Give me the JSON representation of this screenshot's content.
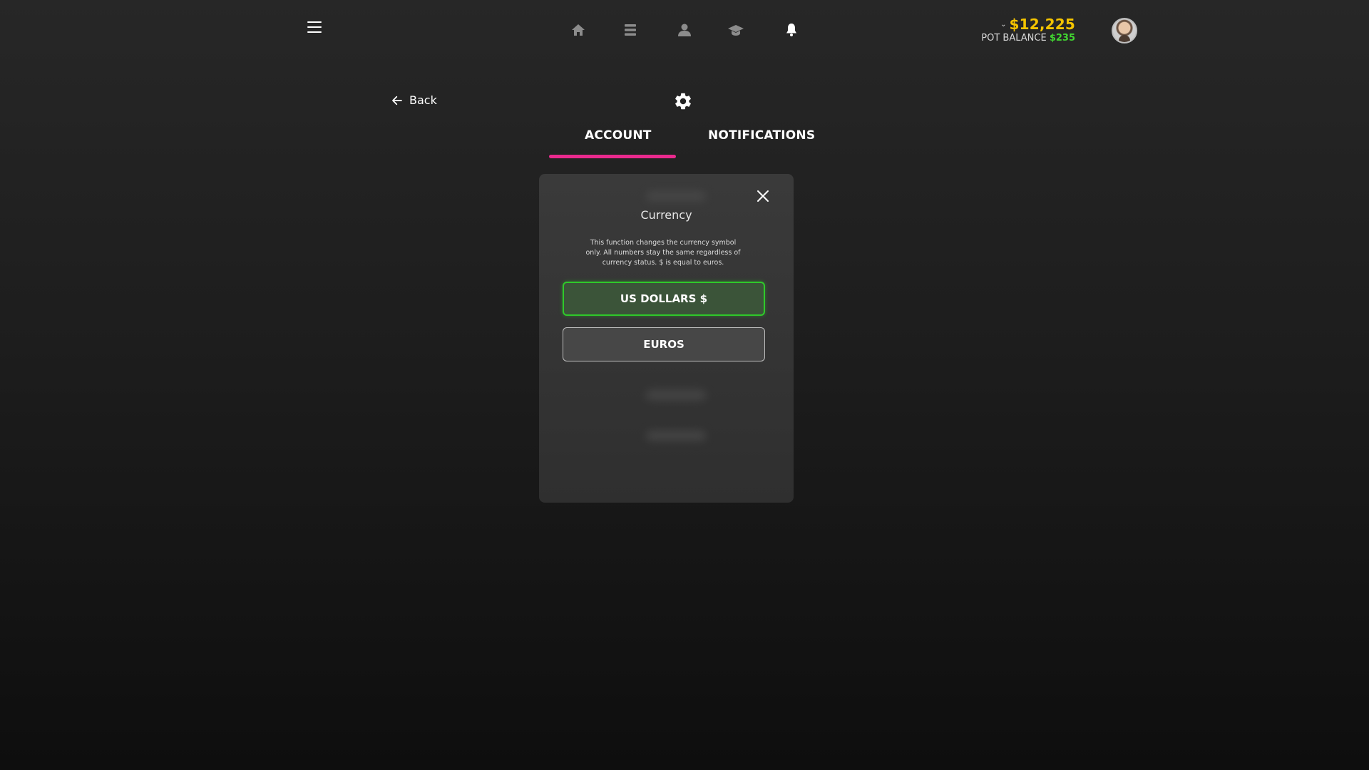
{
  "topbar": {
    "nav": [
      {
        "icon": "home-icon"
      },
      {
        "icon": "list-icon"
      },
      {
        "icon": "user-icon"
      },
      {
        "icon": "graduation-cap-icon"
      },
      {
        "icon": "bell-icon"
      }
    ],
    "balance": "$12,225",
    "pot_label": "POT BALANCE",
    "pot_amount": "$235"
  },
  "header": {
    "back_label": "Back"
  },
  "tabs": [
    {
      "label": "ACCOUNT",
      "active": true
    },
    {
      "label": "NOTIFICATIONS",
      "active": false
    }
  ],
  "modal": {
    "title": "Currency",
    "description": "This function changes the currency symbol only. All numbers stay the same regardless of currency status. $ is equal to euros.",
    "options": [
      {
        "label": "US DOLLARS $",
        "selected": true
      },
      {
        "label": "EUROS",
        "selected": false
      }
    ]
  },
  "colors": {
    "accent_pink": "#ea2a8e",
    "balance_yellow": "#f4c400",
    "pot_green": "#41d431",
    "selected_border": "#2fc92a"
  }
}
